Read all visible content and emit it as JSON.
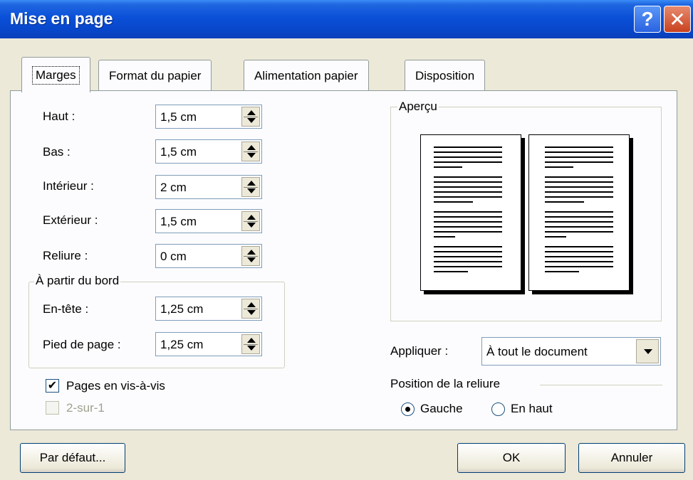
{
  "window": {
    "title": "Mise en page",
    "help_label": "?",
    "close_label": "✕"
  },
  "tabs": [
    {
      "label": "Marges",
      "active": true
    },
    {
      "label": "Format du papier",
      "active": false
    },
    {
      "label": "Alimentation papier",
      "active": false
    },
    {
      "label": "Disposition",
      "active": false
    }
  ],
  "margins": {
    "haut": {
      "label": "Haut :",
      "value": "1,5 cm"
    },
    "bas": {
      "label": "Bas :",
      "value": "1,5 cm"
    },
    "interieur": {
      "label": "Intérieur :",
      "value": "2 cm"
    },
    "exterieur": {
      "label": "Extérieur :",
      "value": "1,5 cm"
    },
    "reliure": {
      "label": "Reliure :",
      "value": "0 cm"
    }
  },
  "from_edge": {
    "title": "À partir du bord",
    "entete": {
      "label": "En-tête :",
      "value": "1,25 cm"
    },
    "pied": {
      "label": "Pied de page :",
      "value": "1,25 cm"
    }
  },
  "options": {
    "vis_a_vis": {
      "label": "Pages en vis-à-vis",
      "checked": true
    },
    "deux_sur_un": {
      "label": "2-sur-1",
      "checked": false,
      "disabled": true
    }
  },
  "preview": {
    "title": "Aperçu"
  },
  "apply": {
    "label": "Appliquer :",
    "value": "À tout le document"
  },
  "binding": {
    "title": "Position de la reliure",
    "left": {
      "label": "Gauche",
      "selected": true
    },
    "top": {
      "label": "En haut",
      "selected": false
    }
  },
  "buttons": {
    "default": "Par défaut...",
    "ok": "OK",
    "cancel": "Annuler"
  },
  "colors": {
    "titlebar": "#0a50d8",
    "dialog_bg": "#ece9d8",
    "panel_bg": "#fcfcfe"
  }
}
